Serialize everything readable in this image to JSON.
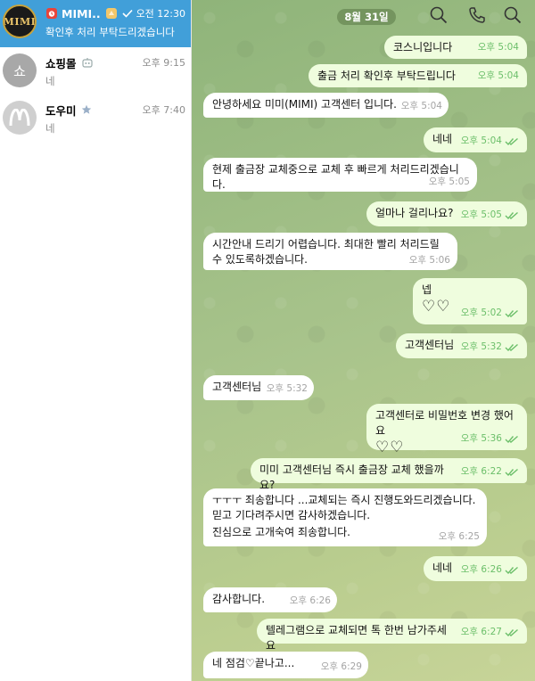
{
  "sidebar": {
    "chats": [
      {
        "avatar_text": "MIMI",
        "name": "MIMI...",
        "name_icon": "alarm-clock-emoji",
        "status_icon": "check-icon",
        "time": "오전 12:30",
        "preview": "확인후 처리 부탁드리겠습니다",
        "active": true
      },
      {
        "avatar_text": "쇼",
        "name": "쇼핑몰",
        "name_icon": "bot-icon",
        "time": "오후 9:15",
        "preview": "네"
      },
      {
        "avatar_text": "M",
        "name": "도우미",
        "name_icon": "star-icon",
        "time": "오후 7:40",
        "preview": "네"
      }
    ]
  },
  "header": {
    "date": "8월 31일",
    "icons": [
      "search-icon",
      "phone-icon",
      "search-icon"
    ]
  },
  "messages": [
    {
      "dir": "out",
      "text": "코스니입니다",
      "time": "오후 5:04",
      "read": false
    },
    {
      "dir": "out",
      "text": "출금 처리 확인후 부탁드립니다",
      "time": "오후 5:04",
      "read": false
    },
    {
      "dir": "in",
      "text": "안녕하세요 미미(MIMI) 고객센터 입니다.",
      "time": "오후 5:04"
    },
    {
      "dir": "out",
      "text": "네네",
      "time": "오후 5:04",
      "read": true
    },
    {
      "dir": "in",
      "text": "현제 출금장 교체중으로 교체 후 빠르게 처리드리겠습니다.",
      "time": "오후 5:05"
    },
    {
      "dir": "out",
      "text": "얼마나 걸리나요?",
      "time": "오후 5:05",
      "read": true
    },
    {
      "dir": "in",
      "text": "시간안내 드리기 어렵습니다. 최대한 빨리 처리드릴 수 있도록하겠습니다.",
      "time": "오후 5:06"
    },
    {
      "dir": "out",
      "text": "넵",
      "hearts": "♡♡",
      "time": "오후 5:02",
      "read": true
    },
    {
      "dir": "out",
      "text": "고객센터님",
      "time": "오후 5:32",
      "read": true
    },
    {
      "dir": "in",
      "text": "고객센터님",
      "time": "오후 5:32"
    },
    {
      "dir": "out",
      "text": "고객센터로 비밀번호 변경 했어요",
      "hearts": "♡♡",
      "time": "오후 5:36",
      "read": true
    },
    {
      "dir": "out",
      "text": "미미 고객센터님 즉시 출금장 교체 했을까요?",
      "time": "오후 6:22",
      "read": true
    },
    {
      "dir": "in",
      "text": "ㅜㅜㅜ 죄송합니다 ...교체되는 즉시 진행도와드리겠습니다. 믿고 기다려주시면 감사하겠습니다.",
      "text2": "진심으로 고개숙여 죄송합니다.",
      "time": "오후 6:25"
    },
    {
      "dir": "out",
      "text": "네네",
      "time": "오후 6:26",
      "read": true
    },
    {
      "dir": "in",
      "text": "감사합니다.",
      "time": "오후 6:26"
    },
    {
      "dir": "out",
      "text": "텔레그램으로 교체되면 톡 한번 남가주세요",
      "time": "오후 6:27",
      "read": true
    },
    {
      "dir": "in",
      "text": "네 점검♡끝나고...",
      "time": "오후 6:29"
    }
  ],
  "colors": {
    "active_chat": "#419fd9",
    "outgoing_bubble": "#effdde",
    "incoming_bubble": "#ffffff",
    "read_check": "#6cbf6a"
  }
}
